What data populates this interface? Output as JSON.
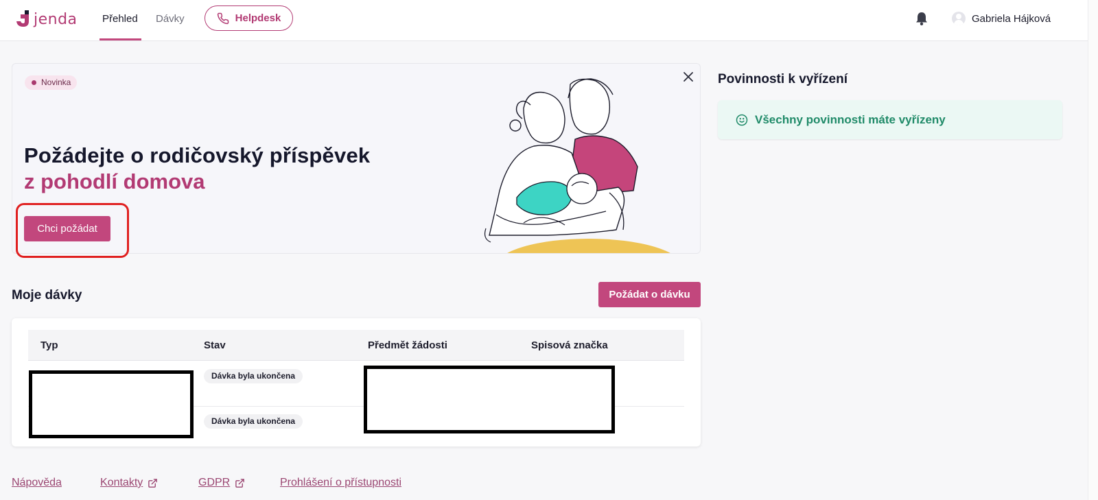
{
  "header": {
    "logo_text": "jenda",
    "nav": [
      {
        "label": "Přehled",
        "active": true
      },
      {
        "label": "Dávky",
        "active": false
      }
    ],
    "helpdesk_label": "Helpdesk",
    "user_name": "Gabriela Hájková"
  },
  "banner": {
    "badge": "Novinka",
    "headline": "Požádejte o rodičovský příspěvek",
    "headline_accent": "z pohodlí domova",
    "cta_label": "Chci požádat"
  },
  "duties": {
    "title": "Povinnosti k vyřízení",
    "message": "Všechny povinnosti máte vyřízeny"
  },
  "benefits": {
    "title": "Moje dávky",
    "request_button": "Požádat o dávku",
    "columns": [
      "Typ",
      "Stav",
      "Předmět žádosti",
      "Spisová značka"
    ],
    "rows": [
      {
        "status": "Dávka byla ukončena"
      },
      {
        "status": "Dávka byla ukončena"
      }
    ]
  },
  "footer": {
    "links": [
      "Nápověda",
      "Kontakty",
      "GDPR",
      "Prohlášení o přístupnosti"
    ]
  },
  "colors": {
    "brand": "#c2477d",
    "brand_dark": "#b23a73",
    "success_bg": "#ebf8f4",
    "success_text": "#1f8a68",
    "illustration_pink": "#c5457b",
    "illustration_teal": "#3dd4c4",
    "illustration_yellow": "#eec455"
  }
}
